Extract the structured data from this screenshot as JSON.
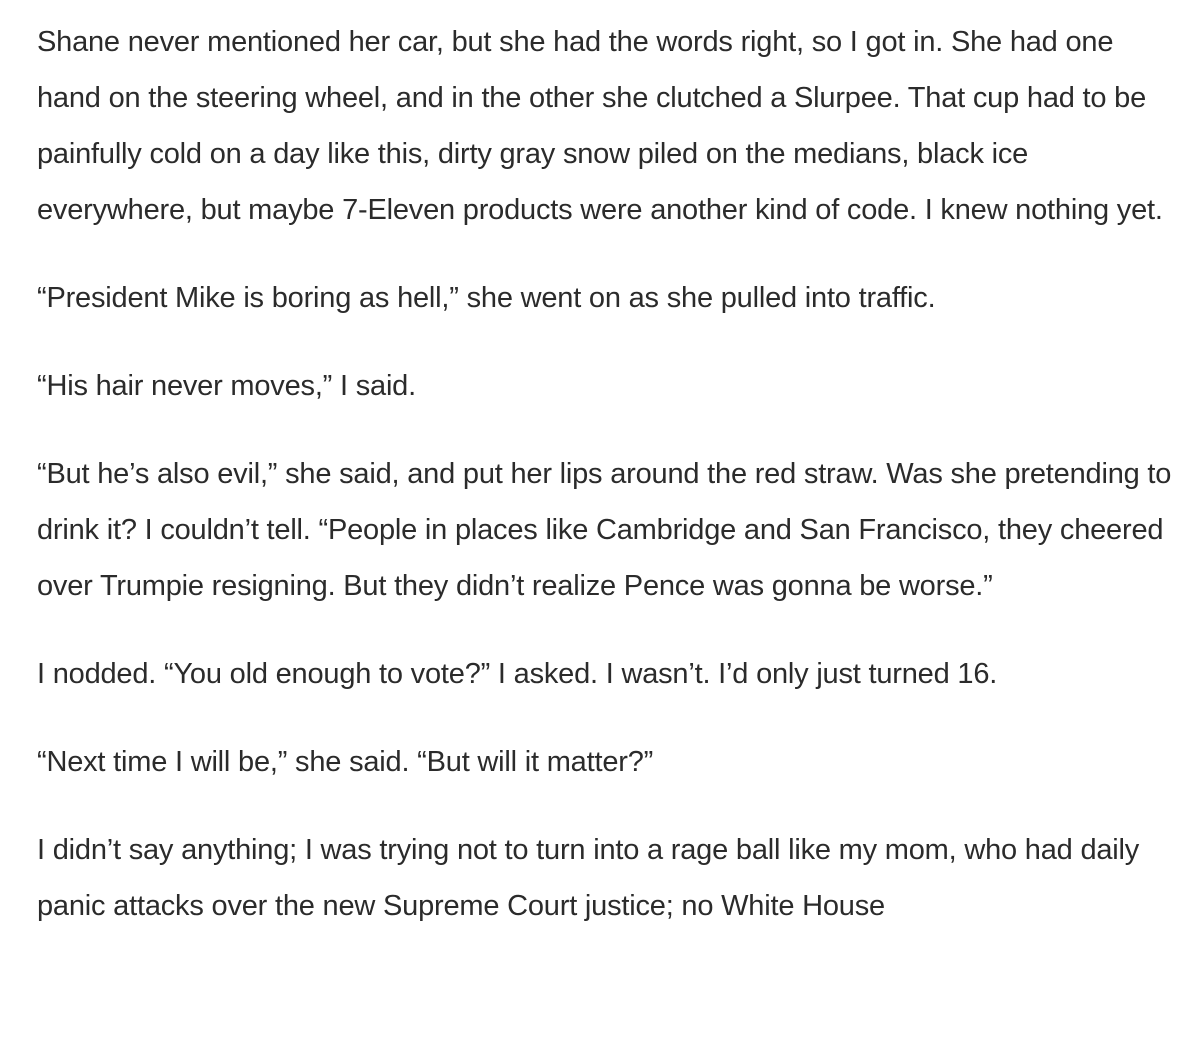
{
  "article": {
    "paragraphs": [
      "Shane never mentioned her car, but she had the words right, so I got in. She had one hand on the steering wheel, and in the other she clutched a Slurpee. That cup had to be painfully cold on a day like this, dirty gray snow piled on the medians, black ice everywhere, but maybe 7-Eleven products were another kind of code. I knew nothing yet.",
      "“President Mike is boring as hell,” she went on as she pulled into traffic.",
      "“His hair never moves,” I said.",
      "“But he’s also evil,” she said, and put her lips around the red straw. Was she pretending to drink it? I couldn’t tell. “People in places like Cambridge and San Francisco, they cheered over Trumpie resigning. But they didn’t realize Pence was gonna be worse.”",
      "I nodded. “You old enough to vote?” I asked. I wasn’t. I’d only just turned 16.",
      "“Next time I will be,” she said. “But will it matter?”",
      "I didn’t say anything; I was trying not to turn into a rage ball like my mom, who had daily panic attacks over the new Supreme Court justice; no White House"
    ]
  }
}
